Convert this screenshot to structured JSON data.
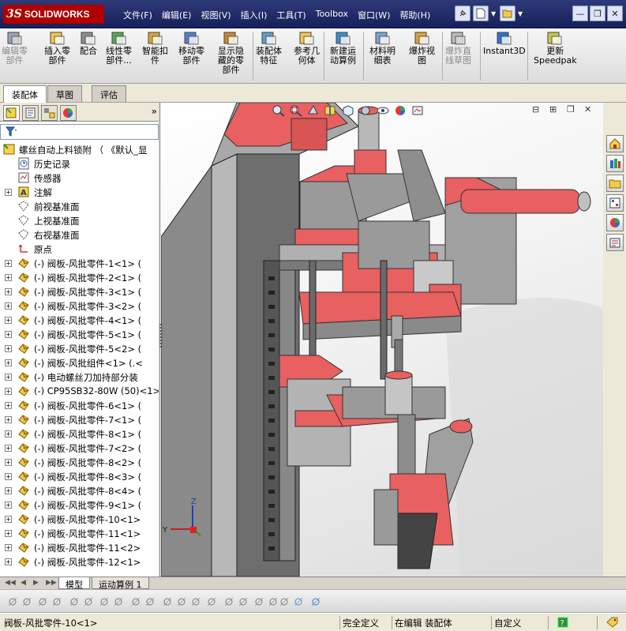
{
  "app": {
    "logo_mark": "3S",
    "logo_text": "SOLIDWORKS"
  },
  "menu": [
    "文件(F)",
    "编辑(E)",
    "视图(V)",
    "插入(I)",
    "工具(T)",
    "Toolbox",
    "窗口(W)",
    "帮助(H)"
  ],
  "title_tools": {
    "pin_icon": "pin-icon",
    "new_icon": "new-document-icon",
    "open_icon": "open-folder-icon"
  },
  "command_manager": [
    {
      "label": "编辑零\n部件",
      "icon": "edit-component-icon",
      "disabled": true
    },
    {
      "label": "插入零\n部件",
      "icon": "insert-component-icon",
      "disabled": false
    },
    {
      "label": "配合",
      "icon": "mate-icon",
      "disabled": false
    },
    {
      "label": "线性零\n部件...",
      "icon": "linear-pattern-icon",
      "disabled": false
    },
    {
      "label": "智能扣\n件",
      "icon": "smart-fasteners-icon",
      "disabled": false
    },
    {
      "label": "移动零\n部件",
      "icon": "move-component-icon",
      "disabled": false
    },
    {
      "label": "显示隐\n藏的零\n部件",
      "icon": "show-hidden-icon",
      "disabled": false
    },
    {
      "label": "装配体\n特征",
      "icon": "assembly-features-icon",
      "disabled": false
    },
    {
      "label": "参考几\n何体",
      "icon": "reference-geometry-icon",
      "disabled": false
    },
    {
      "label": "新建运\n动算例",
      "icon": "new-motion-study-icon",
      "disabled": false
    },
    {
      "label": "材料明\n细表",
      "icon": "bill-of-materials-icon",
      "disabled": false
    },
    {
      "label": "爆炸视\n图",
      "icon": "exploded-view-icon",
      "disabled": false
    },
    {
      "label": "爆炸直\n线草图",
      "icon": "explode-line-sketch-icon",
      "disabled": true
    },
    {
      "label": "Instant3D",
      "icon": "instant3d-icon",
      "disabled": false
    },
    {
      "label": "更新\nSpeedpak",
      "icon": "speedpak-icon",
      "disabled": false
    }
  ],
  "command_tabs": [
    "装配体",
    "草图",
    "评估"
  ],
  "feature_tree": {
    "more_label": "»",
    "root": "螺丝自动上料锁附 （ 《默认_显",
    "fixed_items": [
      {
        "label": "历史记录",
        "icon": "history-icon"
      },
      {
        "label": "传感器",
        "icon": "sensors-icon"
      },
      {
        "label": "注解",
        "icon": "annotations-icon",
        "expandable": true
      },
      {
        "label": "前视基准面",
        "icon": "plane-icon"
      },
      {
        "label": "上视基准面",
        "icon": "plane-icon"
      },
      {
        "label": "右视基准面",
        "icon": "plane-icon"
      },
      {
        "label": "原点",
        "icon": "origin-icon"
      }
    ],
    "components": [
      "(-) 阀板-风批零件-1<1> (",
      "(-) 阀板-风批零件-2<1> (",
      "(-) 阀板-风批零件-3<1> (",
      "(-) 阀板-风批零件-3<2> (",
      "(-) 阀板-风批零件-4<1> (",
      "(-) 阀板-风批零件-5<1> (",
      "(-) 阀板-风批零件-5<2> (",
      "(-) 阀板-风批组件<1> (.<",
      "(-) 电动螺丝刀加持部分装",
      "(-) CP95SB32-80W (50)<1>",
      "(-) 阀板-风批零件-6<1> (",
      "(-) 阀板-风批零件-7<1> (",
      "(-) 阀板-风批零件-8<1> (",
      "(-) 阀板-风批零件-7<2> (",
      "(-) 阀板-风批零件-8<2> (",
      "(-) 阀板-风批零件-8<3> (",
      "(-) 阀板-风批零件-8<4> (",
      "(-) 阀板-风批零件-9<1> (",
      "(-) 阀板-风批零件-10<1>",
      "(-) 阀板-风批零件-11<1>",
      "(-) 阀板-风批零件-11<2>",
      "(-) 阀板-风批零件-12<1>"
    ]
  },
  "viewport": {
    "axis_labels": {
      "x": "X",
      "y": "Y",
      "z": "Z"
    },
    "colors": {
      "body": "#9c9c9c",
      "face": "#e86060",
      "dark": "#555555"
    }
  },
  "bottom_tabs": [
    "模型",
    "运动算例 1"
  ],
  "status_bar": {
    "selection": "阀板-风批零件-10<1>",
    "definition": "完全定义",
    "editing": "在编辑 装配体",
    "units": "自定义"
  }
}
